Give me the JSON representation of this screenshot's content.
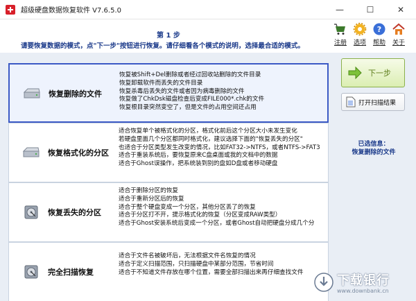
{
  "window": {
    "title": "超级硬盘数据恢复软件 V7.6.5.0",
    "minimize": "—",
    "maximize": "☐",
    "close": "✕"
  },
  "header": {
    "step": "第 1 步",
    "instruction": "请要恢复数据的模式，点\"下一步\"按钮进行恢复。请仔细看各个模式的说明，选择最合适的模式。"
  },
  "toolbar": [
    {
      "label": "注册",
      "icon": "register-icon"
    },
    {
      "label": "选项",
      "icon": "options-icon"
    },
    {
      "label": "帮助",
      "icon": "help-icon"
    },
    {
      "label": "关于",
      "icon": "about-icon"
    }
  ],
  "modes": [
    {
      "name": "恢复删除的文件",
      "selected": true,
      "desc": [
        "恢复被Shift+Del删除或者经过回收站删除的文件目录",
        "恢复卸载软件而丢失的文件目录",
        "恢复杀毒后丢失的文件或者因为病毒删除的文件",
        "恢复做了ChkDsk磁盘检查后变成FILE000*.chk的文件",
        "恢复根目录突然变空了，但是文件的占用空间还占用"
      ]
    },
    {
      "name": "恢复格式化的分区",
      "selected": false,
      "desc": [
        "适合恢复单个被格式化的分区，格式化前后这个分区大小未发生变化",
        "若硬盘里面几个分区都同时格式化，建议选择下面的\"恢复丢失的分区\"",
        "也适合于分区类型发生改变的情况，比如FAT32->NTFS，或者NTFS->FAT3",
        "适合于重装系统后，要恢复原来C盘桌面或我的文档中的数据",
        "适合于Ghost误操作，把系统装到别的盘如D盘或者移动硬盘"
      ]
    },
    {
      "name": "恢复丢失的分区",
      "selected": false,
      "desc": [
        "适合于删除分区的恢复",
        "适合于重新分区后的恢复",
        "适合于整个硬盘变成一个分区，其他分区丢了的恢复",
        "适合于分区打不开，提示格式化的恢复（分区变成RAW类型）",
        "适合于Ghost安装系统后变成一个分区，或者Ghost自动把硬盘分成几个分"
      ]
    },
    {
      "name": "完全扫描恢复",
      "selected": false,
      "desc": [
        "适合于文件名被破坏后，无法根据文件名恢复的情况",
        "适合于定义扫描范围，只扫描硬盘中某部分范围，节省时间",
        "适合于不知道文件存放在哪个位置，需要全部扫描出来再仔细查找文件"
      ]
    }
  ],
  "side": {
    "next": "下一步",
    "open_results": "打开扫描结果",
    "selected_label": "已选信息：",
    "selected_value": "恢复删除的文件"
  },
  "watermark": {
    "main": "下载银行",
    "sub": "www.downbank.cn"
  }
}
